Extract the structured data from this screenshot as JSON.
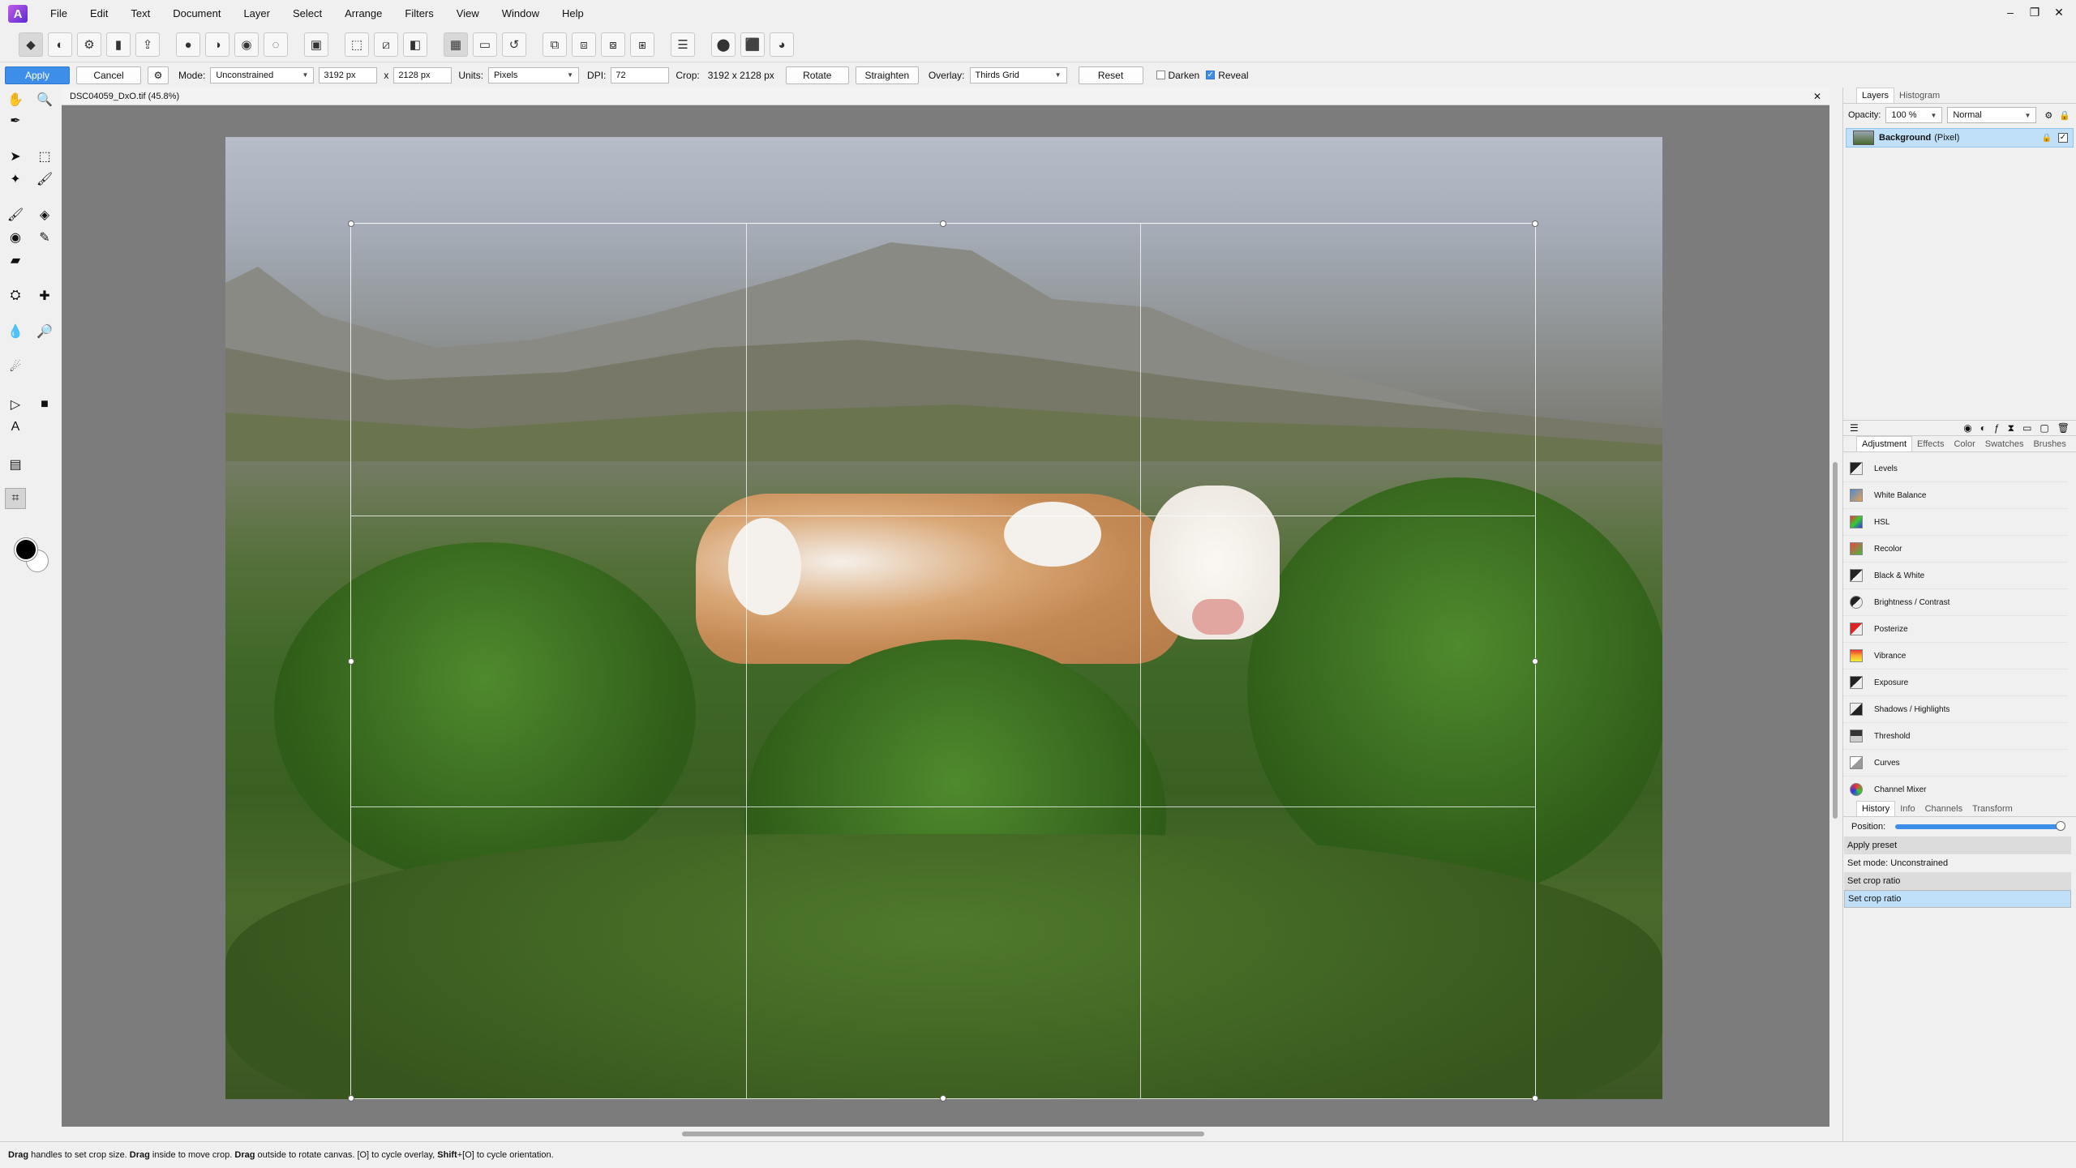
{
  "app": {
    "logo": "A",
    "window_controls": [
      "–",
      "❐",
      "✕"
    ]
  },
  "menu": [
    "File",
    "Edit",
    "Text",
    "Document",
    "Layer",
    "Select",
    "Arrange",
    "Filters",
    "View",
    "Window",
    "Help"
  ],
  "context_bar": {
    "apply_label": "Apply",
    "cancel_label": "Cancel",
    "mode_label": "Mode:",
    "mode_value": "Unconstrained",
    "width_value": "3192 px",
    "times": "x",
    "height_value": "2128 px",
    "units_label": "Units:",
    "units_value": "Pixels",
    "dpi_label": "DPI:",
    "dpi_value": "72",
    "crop_label": "Crop:",
    "crop_value": "3192 x 2128 px",
    "rotate_label": "Rotate",
    "straighten_label": "Straighten",
    "overlay_label": "Overlay:",
    "overlay_value": "Thirds Grid",
    "reset_label": "Reset",
    "darken_label": "Darken",
    "darken_checked": false,
    "reveal_label": "Reveal",
    "reveal_checked": true
  },
  "document": {
    "tab_title": "DSC04059_DxO.tif (45.8%)",
    "close": "✕"
  },
  "layers_panel": {
    "tabs": [
      "Layers",
      "Histogram"
    ],
    "opacity_label": "Opacity:",
    "opacity_value": "100 %",
    "blend_value": "Normal",
    "layer_name": "Background",
    "layer_type": "(Pixel)"
  },
  "adjustment_panel": {
    "tabs": [
      "Adjustment",
      "Effects",
      "Color",
      "Swatches",
      "Brushes"
    ],
    "items": [
      "Levels",
      "White Balance",
      "HSL",
      "Recolor",
      "Black & White",
      "Brightness / Contrast",
      "Posterize",
      "Vibrance",
      "Exposure",
      "Shadows / Highlights",
      "Threshold",
      "Curves",
      "Channel Mixer"
    ]
  },
  "history_panel": {
    "tabs": [
      "History",
      "Info",
      "Channels",
      "Transform"
    ],
    "position_label": "Position:",
    "position_fraction": 1.0,
    "items": [
      "Apply preset",
      "Set mode: Unconstrained",
      "Set crop ratio",
      "Set crop ratio"
    ]
  },
  "status": {
    "drag1": "Drag",
    "text1": " handles to set crop size. ",
    "drag2": "Drag",
    "text2": " inside to move crop. ",
    "drag3": "Drag",
    "text3": " outside to rotate canvas. [O] to cycle overlay, ",
    "shift": "Shift",
    "text4": "+[O] to cycle orientation."
  },
  "colors": {
    "accent": "#3d8ee9",
    "selection": "#bfe0f8",
    "canvas_bg": "#7c7c7c"
  }
}
